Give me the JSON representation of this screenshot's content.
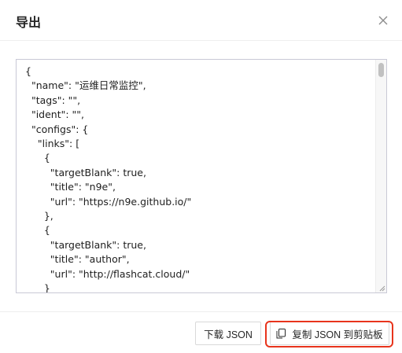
{
  "dialog": {
    "title": "导出",
    "close_icon": "close-icon"
  },
  "editor": {
    "lines": [
      "{",
      "  \"name\": \"运维日常监控\",",
      "  \"tags\": \"\",",
      "  \"ident\": \"\",",
      "  \"configs\": {",
      "    \"links\": [",
      "      {",
      "        \"targetBlank\": true,",
      "        \"title\": \"n9e\",",
      "        \"url\": \"https://n9e.github.io/\"",
      "      },",
      "      {",
      "        \"targetBlank\": true,",
      "        \"title\": \"author\",",
      "        \"url\": \"http://flashcat.cloud/\"",
      "      }"
    ]
  },
  "footer": {
    "download_label": "下载 JSON",
    "copy_label": "复制 JSON 到剪贴板",
    "copy_icon": "copy-icon",
    "highlight_color": "#e8341c"
  }
}
